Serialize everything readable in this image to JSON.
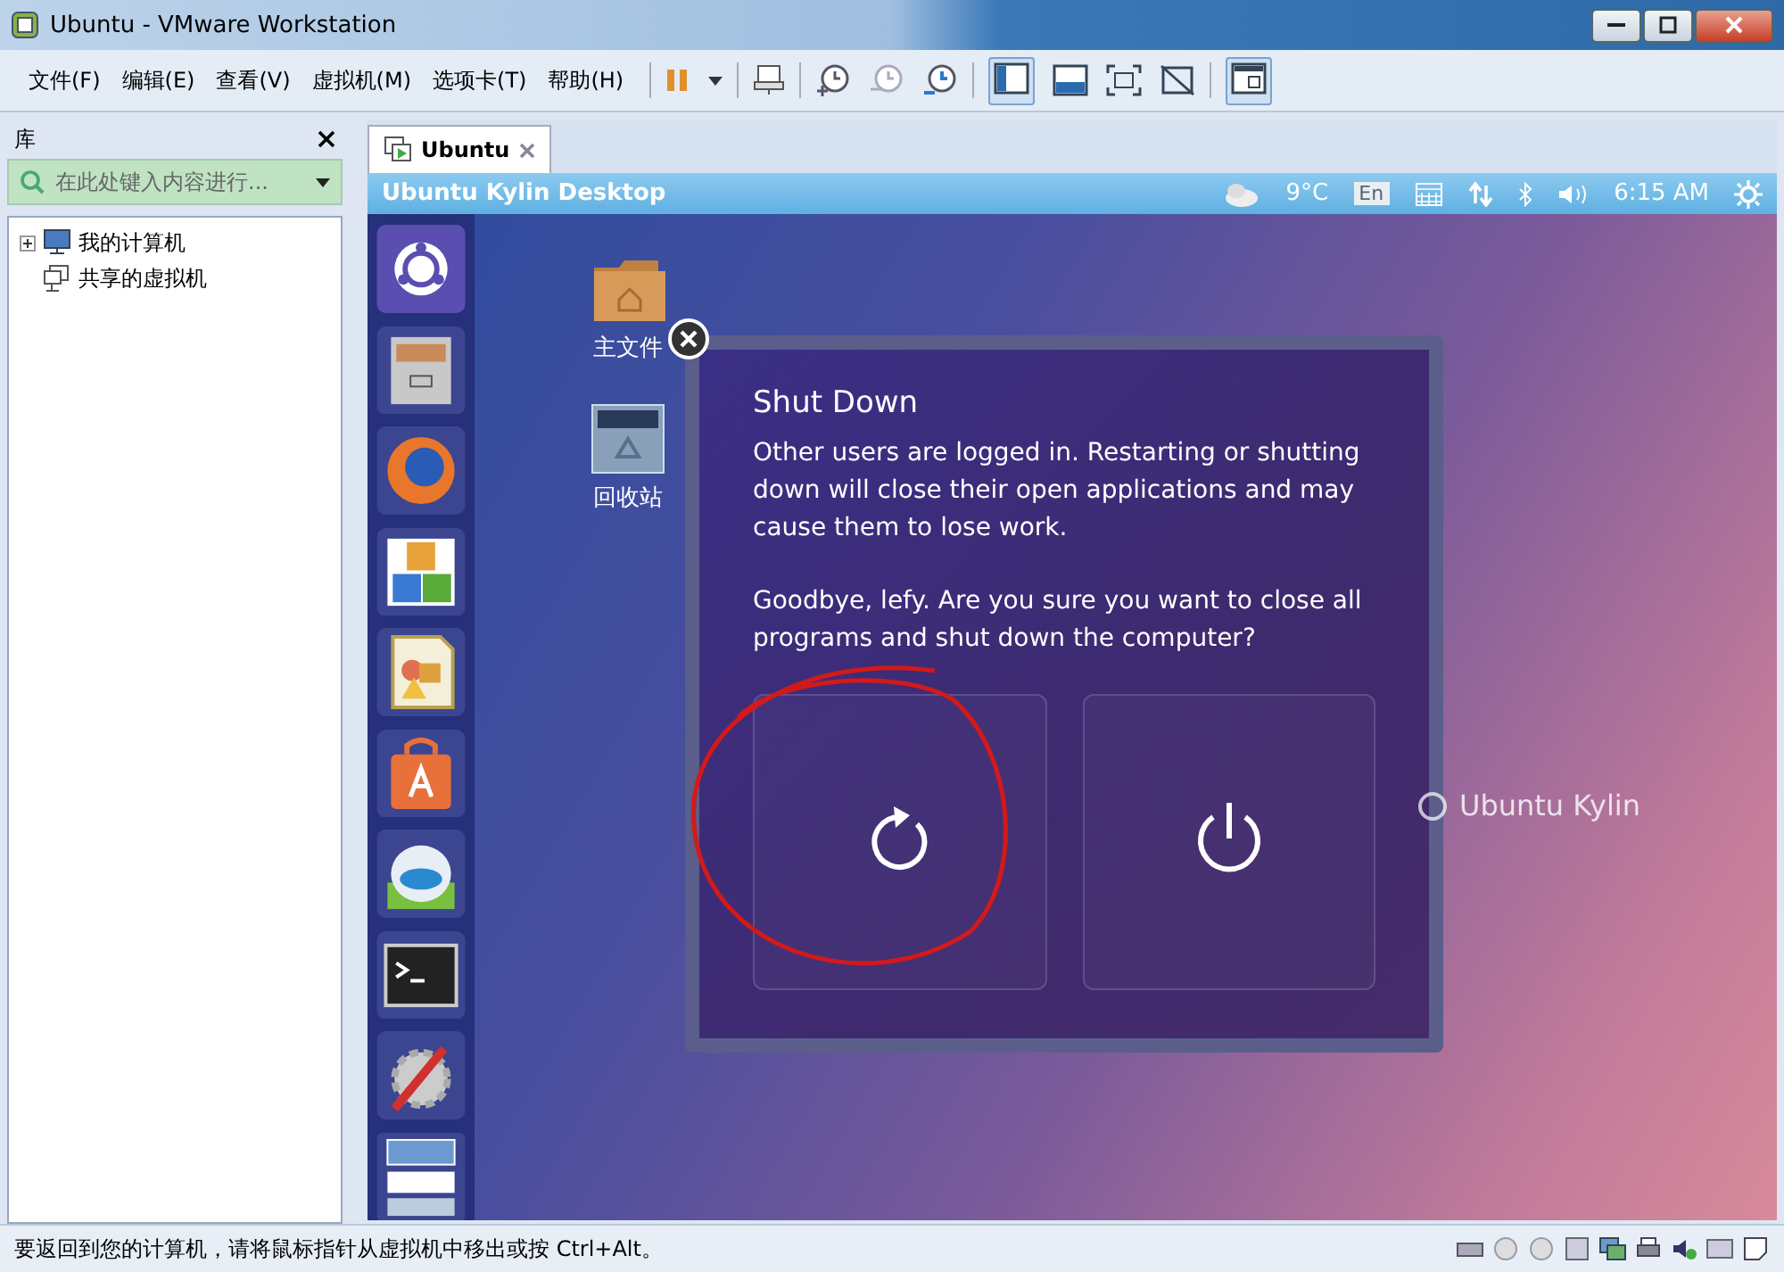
{
  "window": {
    "title": "Ubuntu - VMware Workstation"
  },
  "menu": [
    "文件(F)",
    "编辑(E)",
    "查看(V)",
    "虚拟机(M)",
    "选项卡(T)",
    "帮助(H)"
  ],
  "library": {
    "title": "库",
    "search": {
      "placeholder": "在此处键入内容进行..."
    },
    "tree": [
      {
        "label": "我的计算机",
        "kind": "computer",
        "expanded": false
      },
      {
        "label": "共享的虚拟机",
        "kind": "shared"
      }
    ]
  },
  "tabs": [
    {
      "label": "Ubuntu",
      "selected": true
    }
  ],
  "guest": {
    "panel_title": "Ubuntu Kylin Desktop",
    "weather": "9°C",
    "keyboard": "En",
    "clock": "6:15 AM",
    "desktop_icons": [
      {
        "label": "主文件",
        "kind": "folder"
      },
      {
        "label": "回收站",
        "kind": "trash"
      }
    ],
    "brand": "Ubuntu Kylin",
    "dialog": {
      "title": "Shut Down",
      "message": "Other users are logged in. Restarting or shutting down will close their open applications and may cause them to lose work.",
      "question": "Goodbye, lefy. Are you sure you want to close all programs and shut down the computer?",
      "actions": [
        {
          "kind": "restart"
        },
        {
          "kind": "shutdown"
        }
      ]
    }
  },
  "status_bar": {
    "text": "要返回到您的计算机，请将鼠标指针从虚拟机中移出或按 Ctrl+Alt。"
  }
}
